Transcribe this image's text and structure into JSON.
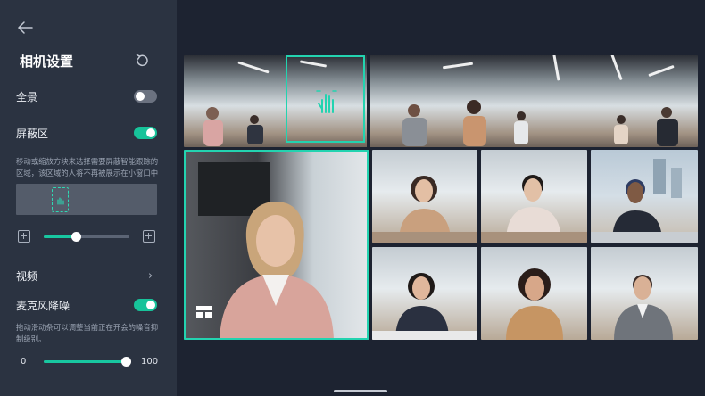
{
  "panel": {
    "title": "相机设置",
    "panorama_label": "全景",
    "panorama_on": false,
    "mask_label": "屏蔽区",
    "mask_on": true,
    "mask_help": "移动或缩放方块来选择需要屏蔽智能跟踪的区域，该区域的人将不再被展示在小窗口中",
    "video_label": "视频",
    "mic_label": "麦克风降噪",
    "mic_on": true,
    "mic_help": "拖动滑动条可以调整当前正在开会的噪音抑制级别。",
    "mask_zoom_level": 0.38,
    "noise_min": "0",
    "noise_max": "100",
    "noise_value": 100
  },
  "colors": {
    "accent": "#18c7a0",
    "panel_bg": "#2b3341",
    "stage_bg": "#1d2331"
  },
  "icons": [
    "back-arrow-icon",
    "reset-icon",
    "zoom-out-icon",
    "zoom-in-icon",
    "chevron-right-icon",
    "hand-drag-icon",
    "layout-icon"
  ]
}
